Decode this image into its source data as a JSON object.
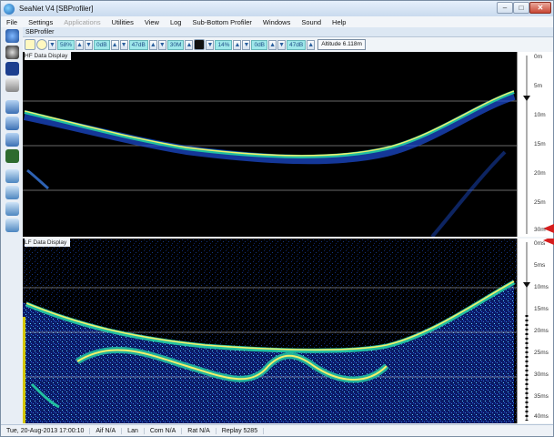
{
  "window": {
    "title": "SeaNet V4 [SBProfiler]"
  },
  "menu": {
    "items": [
      {
        "label": "File",
        "enabled": true
      },
      {
        "label": "Settings",
        "enabled": true
      },
      {
        "label": "Applications",
        "enabled": false
      },
      {
        "label": "Utilities",
        "enabled": true
      },
      {
        "label": "View",
        "enabled": true
      },
      {
        "label": "Log",
        "enabled": true
      },
      {
        "label": "Sub-Bottom Profiler",
        "enabled": true
      },
      {
        "label": "Windows",
        "enabled": true
      },
      {
        "label": "Sound",
        "enabled": true
      },
      {
        "label": "Help",
        "enabled": true
      }
    ]
  },
  "subwindow": {
    "title": "SBProfiler"
  },
  "controls": {
    "hf_gain": "58%",
    "hf_db": "0dB",
    "hf_level": "47dB",
    "hf_range": "30M",
    "lf_gain": "14%",
    "lf_db": "0dB",
    "lf_level": "47dB",
    "altitude": "Altitude 6.118m"
  },
  "hf_panel": {
    "label": "HF Data Display",
    "scale": [
      "0m",
      "5m",
      "10m",
      "15m",
      "20m",
      "25m",
      "30m"
    ],
    "depth_marker": 7
  },
  "lf_panel": {
    "label": "LF Data Display",
    "scale": [
      "0ms",
      "5ms",
      "10ms",
      "15ms",
      "20ms",
      "25ms",
      "30ms",
      "35ms",
      "40ms"
    ]
  },
  "status": {
    "datetime": "Tue, 20-Aug-2013 17:00:10",
    "aif": "Aif N/A",
    "lan": "Lan",
    "com": "Com N/A",
    "rat": "Rat N/A",
    "replay": "Replay 5285"
  },
  "colors": {
    "echo_strong": "#f4f06a",
    "echo_mid": "#22c0a0",
    "echo_weak": "#1c4fd8",
    "background": "#000000"
  }
}
